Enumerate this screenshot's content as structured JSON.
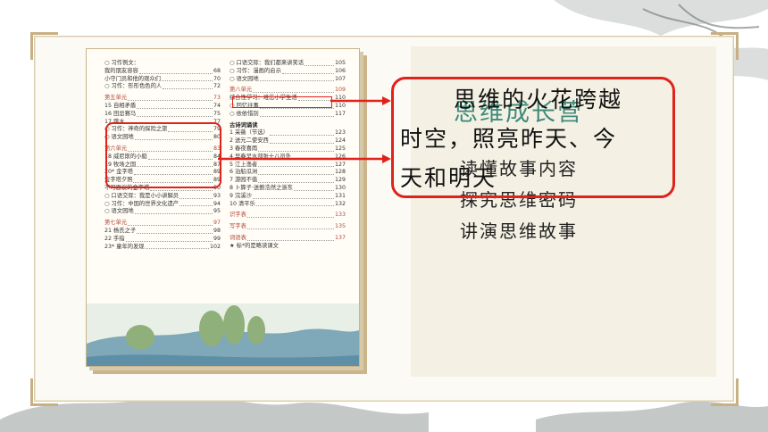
{
  "accent_red": "#e0221b",
  "accent_green": "#3f8a7a",
  "callout": {
    "line1": "思维的火花跨越",
    "line2": "时空，照亮昨天、今",
    "line3": "天和明天"
  },
  "right_panel": {
    "title": "思维成长营",
    "items": [
      "读懂故事内容",
      "探究思维密码",
      "讲演思维故事"
    ]
  },
  "toc_left": [
    {
      "kind": "row",
      "text": "○  习作例文：",
      "page": ""
    },
    {
      "kind": "row",
      "text": "      我的朋友容容",
      "page": "68"
    },
    {
      "kind": "row",
      "text": "      小守门员和他的观众们",
      "page": "70"
    },
    {
      "kind": "row",
      "text": "○  习作：形形色色的人",
      "page": "72"
    },
    {
      "kind": "unit",
      "text": "第五单元",
      "page": "73"
    },
    {
      "kind": "row",
      "text": "15  自相矛盾",
      "page": "74"
    },
    {
      "kind": "row",
      "text": "16  田忌赛马",
      "page": "75"
    },
    {
      "kind": "row",
      "text": "17  跳水",
      "page": "77"
    },
    {
      "kind": "row",
      "text": "○  习作：神奇的探险之旅",
      "page": "79"
    },
    {
      "kind": "row",
      "text": "○  语文园地",
      "page": "80"
    },
    {
      "kind": "unit",
      "text": "第六单元",
      "page": "83"
    },
    {
      "kind": "row",
      "text": "18  威尼斯的小艇",
      "page": "84"
    },
    {
      "kind": "row",
      "text": "19  牧场之国",
      "page": "87"
    },
    {
      "kind": "row",
      "text": "20* 金字塔",
      "page": "89"
    },
    {
      "kind": "row",
      "text": "      金字塔夕照",
      "page": "89"
    },
    {
      "kind": "row",
      "text": "      不可思议的金字塔",
      "page": "90"
    },
    {
      "kind": "row",
      "text": "○  口语交际：我是小小讲解员",
      "page": "93"
    },
    {
      "kind": "row",
      "text": "○  习作：中国的世界文化遗产",
      "page": "94"
    },
    {
      "kind": "row",
      "text": "○  语文园地",
      "page": "95"
    },
    {
      "kind": "unit",
      "text": "第七单元",
      "page": "97"
    },
    {
      "kind": "row",
      "text": "21  杨氏之子",
      "page": "98"
    },
    {
      "kind": "row",
      "text": "22  手指",
      "page": "99"
    },
    {
      "kind": "row",
      "text": "23* 童年的发现",
      "page": "102"
    }
  ],
  "toc_right": [
    {
      "kind": "row",
      "text": "○  口语交际：我们都来讲笑话",
      "page": "105"
    },
    {
      "kind": "row",
      "text": "○  习作：漫画的启示",
      "page": "106"
    },
    {
      "kind": "row",
      "text": "○  语文园地",
      "page": "107"
    },
    {
      "kind": "unit",
      "text": "第八单元",
      "page": "109"
    },
    {
      "kind": "row",
      "text": "综合性学习：难忘小学生活",
      "page": "110"
    },
    {
      "kind": "row",
      "text": "○  回忆往事",
      "page": "110"
    },
    {
      "kind": "row",
      "text": "○  依依惜别",
      "page": "117"
    },
    {
      "kind": "hd",
      "text": "古诗词诵读",
      "page": ""
    },
    {
      "kind": "row",
      "text": "1   采薇（节选）",
      "page": "123"
    },
    {
      "kind": "row",
      "text": "2   送元二使安西",
      "page": "124"
    },
    {
      "kind": "row",
      "text": "3   春夜喜雨",
      "page": "125"
    },
    {
      "kind": "row",
      "text": "4   早春呈水部张十八员外",
      "page": "126"
    },
    {
      "kind": "row",
      "text": "5   江上渔者",
      "page": "127"
    },
    {
      "kind": "row",
      "text": "6   泊船瓜洲",
      "page": "128"
    },
    {
      "kind": "row",
      "text": "7   游园不值",
      "page": "129"
    },
    {
      "kind": "row",
      "text": "8   卜算子·送鲍浩然之浙东",
      "page": "130"
    },
    {
      "kind": "row",
      "text": "9   浣溪沙",
      "page": "131"
    },
    {
      "kind": "row",
      "text": "10  清平乐",
      "page": "132"
    },
    {
      "kind": "unit",
      "text": "识字表",
      "page": "133"
    },
    {
      "kind": "unit",
      "text": "写字表",
      "page": "135"
    },
    {
      "kind": "unit",
      "text": "词语表",
      "page": "137"
    },
    {
      "kind": "note",
      "text": "★ 标*的是略读课文",
      "page": ""
    }
  ]
}
